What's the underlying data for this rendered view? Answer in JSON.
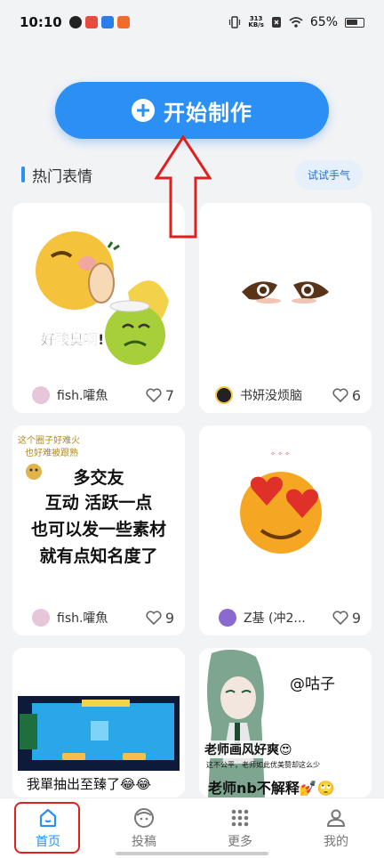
{
  "status_bar": {
    "time": "10:10",
    "net_speed_value": "313",
    "net_speed_unit": "KB/s",
    "battery": "65%"
  },
  "start_button": {
    "label": "开始制作"
  },
  "section": {
    "title": "热门表情",
    "try_label": "试试手气"
  },
  "cards": [
    {
      "author": "fish.嚯魚",
      "likes": "7",
      "caption": "好酸臭啊!"
    },
    {
      "author": "书妍没烦脑",
      "likes": "6"
    },
    {
      "author": "fish.嚯魚",
      "likes": "9",
      "small_text_1": "这个圈子好难火",
      "small_text_2": "也好难被跟熟",
      "lines": [
        "多交友",
        "互动 活跃一点",
        "也可以发一些素材",
        "就有点知名度了"
      ]
    },
    {
      "author": "Z基 (冲2...",
      "likes": "9"
    },
    {
      "caption": "我單抽出至臻了😂😂"
    },
    {
      "handle": "@咕子",
      "line1": "老师画风好爽😍",
      "line2": "这不公平，老师如此优美赞却这么少",
      "line3": "老师nb不解释💅🙄"
    }
  ],
  "nav": {
    "items": [
      {
        "label": "首页",
        "icon": "home-icon"
      },
      {
        "label": "投稿",
        "icon": "face-icon"
      },
      {
        "label": "更多",
        "icon": "grid-icon"
      },
      {
        "label": "我的",
        "icon": "user-icon"
      }
    ]
  },
  "colors": {
    "accent": "#2b8ff3",
    "annotation": "#e0201f"
  }
}
